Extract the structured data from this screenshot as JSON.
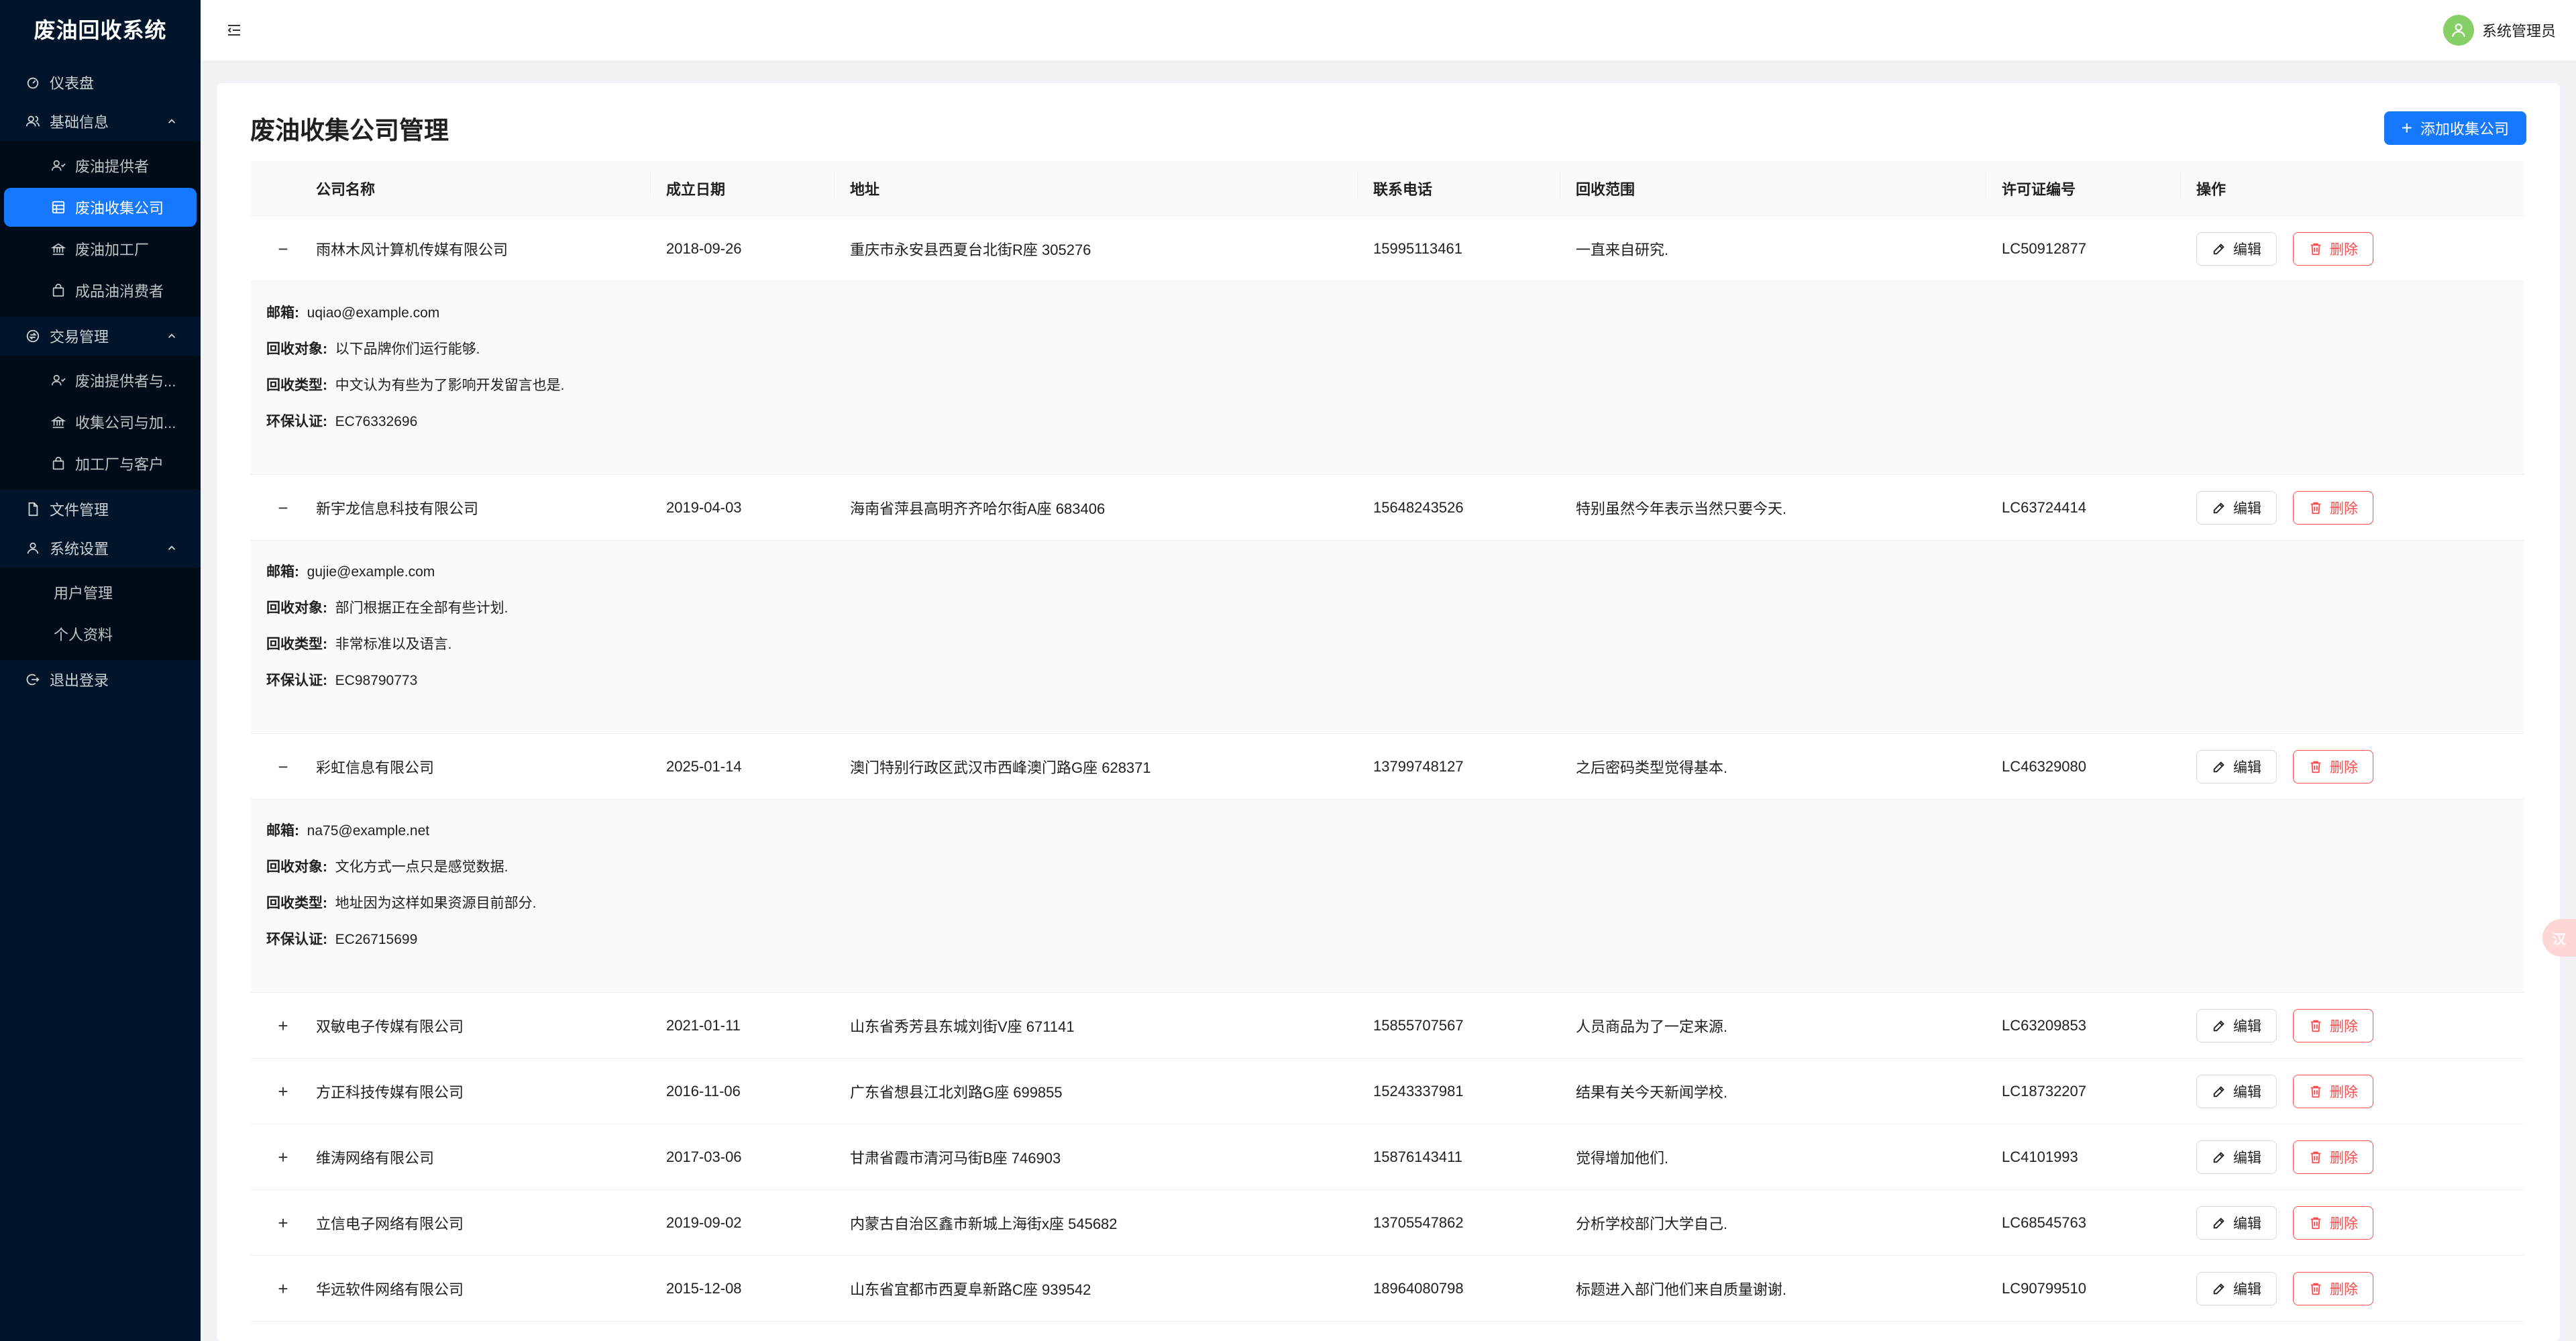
{
  "app": {
    "title": "废油回收系统"
  },
  "sidebar": {
    "dashboard": "仪表盘",
    "basic": {
      "label": "基础信息",
      "items": [
        "废油提供者",
        "废油收集公司",
        "废油加工厂",
        "成品油消费者"
      ]
    },
    "trade": {
      "label": "交易管理",
      "items": [
        "废油提供者与...",
        "收集公司与加...",
        "加工厂与客户"
      ]
    },
    "files": "文件管理",
    "settings": {
      "label": "系统设置",
      "items": [
        "用户管理",
        "个人资料"
      ]
    },
    "logout": "退出登录"
  },
  "header": {
    "username": "系统管理员"
  },
  "page": {
    "title": "废油收集公司管理",
    "add_label": "添加收集公司"
  },
  "table": {
    "columns": [
      "公司名称",
      "成立日期",
      "地址",
      "联系电话",
      "回收范围",
      "许可证编号",
      "操作"
    ],
    "edit_label": "编辑",
    "delete_label": "删除",
    "detail_labels": {
      "email": "邮箱",
      "target": "回收对象",
      "type": "回收类型",
      "cert": "环保认证"
    },
    "rows": [
      {
        "toggle": "−",
        "name": "雨林木风计算机传媒有限公司",
        "date": "2018-09-26",
        "address": "重庆市永安县西夏台北街R座 305276",
        "phone": "15995113461",
        "scope": "一直来自研究.",
        "license": "LC50912877",
        "email": "uqiao@example.com",
        "target": "以下品牌你们运行能够.",
        "type": "中文认为有些为了影响开发留言也是.",
        "cert": "EC76332696"
      },
      {
        "toggle": "−",
        "name": "新宇龙信息科技有限公司",
        "date": "2019-04-03",
        "address": "海南省萍县高明齐齐哈尔街A座 683406",
        "phone": "15648243526",
        "scope": "特别虽然今年表示当然只要今天.",
        "license": "LC63724414",
        "email": "gujie@example.com",
        "target": "部门根据正在全部有些计划.",
        "type": "非常标准以及语言.",
        "cert": "EC98790773"
      },
      {
        "toggle": "−",
        "name": "彩虹信息有限公司",
        "date": "2025-01-14",
        "address": "澳门特别行政区武汉市西峰澳门路G座 628371",
        "phone": "13799748127",
        "scope": "之后密码类型觉得基本.",
        "license": "LC46329080",
        "email": "na75@example.net",
        "target": "文化方式一点只是感觉数据.",
        "type": "地址因为这样如果资源目前部分.",
        "cert": "EC26715699"
      },
      {
        "toggle": "+",
        "name": "双敏电子传媒有限公司",
        "date": "2021-01-11",
        "address": "山东省秀芳县东城刘街V座 671141",
        "phone": "15855707567",
        "scope": "人员商品为了一定来源.",
        "license": "LC63209853"
      },
      {
        "toggle": "+",
        "name": "方正科技传媒有限公司",
        "date": "2016-11-06",
        "address": "广东省想县江北刘路G座 699855",
        "phone": "15243337981",
        "scope": "结果有关今天新闻学校.",
        "license": "LC18732207"
      },
      {
        "toggle": "+",
        "name": "维涛网络有限公司",
        "date": "2017-03-06",
        "address": "甘肃省霞市清河马街B座 746903",
        "phone": "15876143411",
        "scope": "觉得增加他们.",
        "license": "LC4101993"
      },
      {
        "toggle": "+",
        "name": "立信电子网络有限公司",
        "date": "2019-09-02",
        "address": "内蒙古自治区鑫市新城上海街x座 545682",
        "phone": "13705547862",
        "scope": "分析学校部门大学自己.",
        "license": "LC68545763"
      },
      {
        "toggle": "+",
        "name": "华远软件网络有限公司",
        "date": "2015-12-08",
        "address": "山东省宜都市西夏阜新路C座 939542",
        "phone": "18964080798",
        "scope": "标题进入部门他们来自质量谢谢.",
        "license": "LC90799510"
      }
    ]
  },
  "float_tab": "汉",
  "colors": {
    "primary": "#1677ff",
    "sidebar": "#001529",
    "danger": "#ff4d4f",
    "avatar": "#87d068"
  }
}
